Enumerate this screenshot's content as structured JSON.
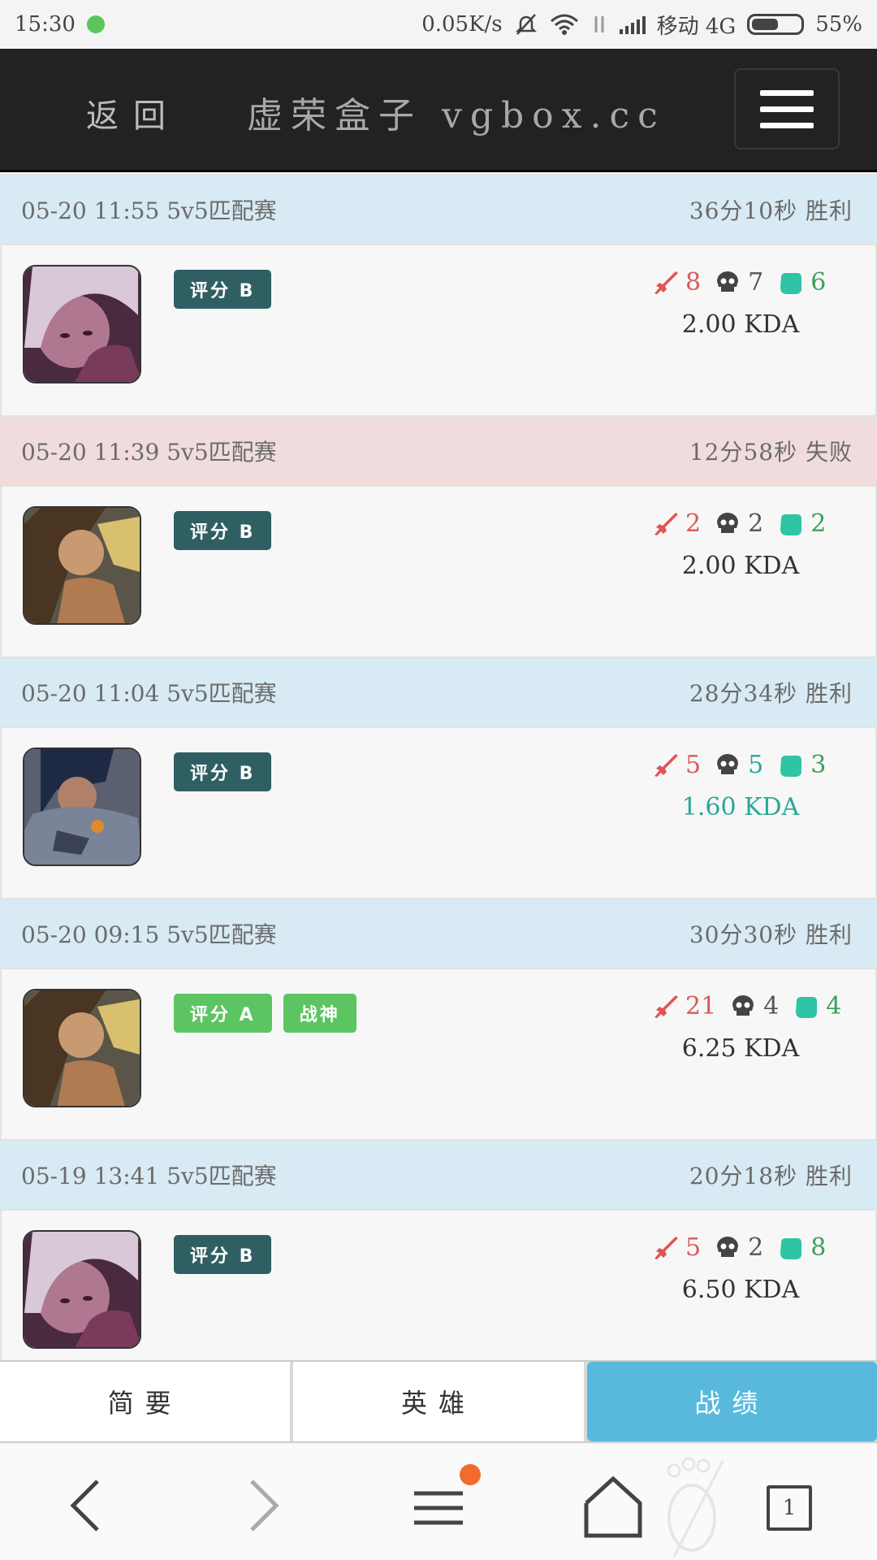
{
  "status_bar": {
    "time": "15:30",
    "net_speed": "0.05K/s",
    "carrier": "移动 4G",
    "battery": "55%",
    "battery_level": 0.55
  },
  "header": {
    "back_label": "返回",
    "title": "虚荣盒子 vgbox.cc"
  },
  "matches": [
    {
      "time": "05-20 11:55",
      "mode": "5v5匹配赛",
      "duration": "36分10秒",
      "result": "胜利",
      "result_type": "win",
      "badges": [
        "评分 B"
      ],
      "kills": "8",
      "deaths": "7",
      "assists": "6",
      "kda": "2.00 KDA",
      "hero": "purple-hair-hero"
    },
    {
      "time": "05-20 11:39",
      "mode": "5v5匹配赛",
      "duration": "12分58秒",
      "result": "失败",
      "result_type": "loss",
      "badges": [
        "评分 B"
      ],
      "kills": "2",
      "deaths": "2",
      "assists": "2",
      "kda": "2.00 KDA",
      "hero": "brown-hair-hero"
    },
    {
      "time": "05-20 11:04",
      "mode": "5v5匹配赛",
      "duration": "28分34秒",
      "result": "胜利",
      "result_type": "win",
      "badges": [
        "评分 B"
      ],
      "kills": "5",
      "deaths": "5",
      "assists": "3",
      "kda": "1.60 KDA",
      "hero": "armored-hero"
    },
    {
      "time": "05-20 09:15",
      "mode": "5v5匹配赛",
      "duration": "30分30秒",
      "result": "胜利",
      "result_type": "win",
      "badges": [
        "评分 A",
        "战神"
      ],
      "kills": "21",
      "deaths": "4",
      "assists": "4",
      "kda": "6.25 KDA",
      "hero": "brown-hair-hero"
    },
    {
      "time": "05-19 13:41",
      "mode": "5v5匹配赛",
      "duration": "20分18秒",
      "result": "胜利",
      "result_type": "win",
      "badges": [
        "评分 B"
      ],
      "kills": "5",
      "deaths": "2",
      "assists": "8",
      "kda": "6.50 KDA",
      "hero": "purple-hair-hero"
    }
  ],
  "tabs": {
    "summary": "简要",
    "heroes": "英雄",
    "record": "战绩"
  },
  "browser_nav": {
    "tab_count": "1"
  },
  "colors": {
    "win_bg": "#d8eaf3",
    "loss_bg": "#f0dcdd",
    "active_tab": "#58b9dd",
    "badge_dark": "#2f5f63",
    "badge_green": "#5cc562"
  }
}
